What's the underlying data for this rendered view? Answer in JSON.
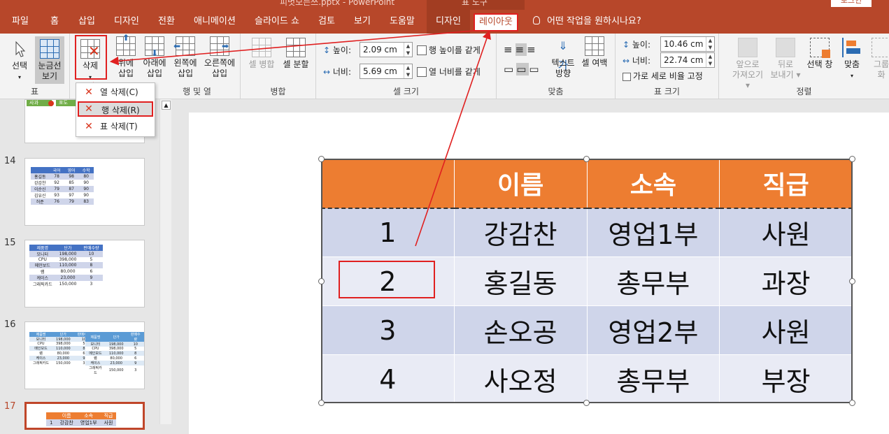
{
  "window": {
    "doc_title": "피벗모든쓰.pptx - PowerPoint",
    "context_group": "표 도구",
    "signin": "로그인"
  },
  "tabs": [
    {
      "label": "파일"
    },
    {
      "label": "홈"
    },
    {
      "label": "삽입"
    },
    {
      "label": "디자인"
    },
    {
      "label": "전환"
    },
    {
      "label": "애니메이션"
    },
    {
      "label": "슬라이드 쇼"
    },
    {
      "label": "검토"
    },
    {
      "label": "보기"
    },
    {
      "label": "도움말"
    },
    {
      "label": "디자인"
    },
    {
      "label": "레이아웃"
    }
  ],
  "tellme": "어떤 작업을 원하시나요?",
  "ribbon": {
    "table_group": {
      "label": "표",
      "select": "선택",
      "gridlines_1": "눈금선",
      "gridlines_2": "보기"
    },
    "rows_cols_group": {
      "label": "행 및 열",
      "delete": "삭제",
      "above_1": "위에",
      "above_2": "삽입",
      "below_1": "아래에",
      "below_2": "삽입",
      "left_1": "왼쪽에",
      "left_2": "삽입",
      "right_1": "오른쪽에",
      "right_2": "삽입"
    },
    "merge_group": {
      "label": "병합",
      "merge_cells": "셀 병합",
      "split_cells": "셀 분할"
    },
    "cell_size_group": {
      "label": "셀 크기",
      "height_label": "높이:",
      "height_value": "2.09 cm",
      "width_label": "너비:",
      "width_value": "5.69 cm",
      "dist_rows": "행 높이를 같게",
      "dist_cols": "열 너비를 같게"
    },
    "align_group": {
      "label": "맞춤",
      "text_dir_1": "텍스트",
      "text_dir_2": "방향",
      "cell_margins": "셀 여백"
    },
    "table_size_group": {
      "label": "표 크기",
      "height_label": "높이:",
      "height_value": "10.46 cm",
      "width_label": "너비:",
      "width_value": "22.74 cm",
      "lock_ratio": "가로 세로 비율 고정"
    },
    "arrange_group": {
      "label": "정렬",
      "bring_forward_1": "앞으로",
      "bring_forward_2": "가져오기",
      "send_backward_1": "뒤로",
      "send_backward_2": "보내기",
      "selection_pane": "선택 창",
      "align": "맞춤",
      "group_1": "그룹",
      "group_2": "화"
    }
  },
  "delete_menu": [
    {
      "label": "열 삭제(C)"
    },
    {
      "label": "행 삭제(R)"
    },
    {
      "label": "표 삭제(T)"
    }
  ],
  "slides": [
    {
      "number": "14"
    },
    {
      "number": "15"
    },
    {
      "number": "16"
    },
    {
      "number": "17"
    }
  ],
  "thumb13": {
    "c1": "사과",
    "c2": "포도"
  },
  "thumb14": {
    "header": [
      "",
      "국어",
      "영어",
      "수학"
    ],
    "rows": [
      [
        "홍길동",
        "78",
        "98",
        "80"
      ],
      [
        "강감찬",
        "92",
        "85",
        "90"
      ],
      [
        "이순신",
        "79",
        "87",
        "90"
      ],
      [
        "김유신",
        "93",
        "97",
        "90"
      ],
      [
        "허준",
        "76",
        "79",
        "83"
      ]
    ]
  },
  "thumb15": {
    "header": [
      "제품명",
      "단가",
      "판매수량"
    ],
    "rows": [
      [
        "모니터",
        "198,000",
        "10"
      ],
      [
        "CPU",
        "398,000",
        "5"
      ],
      [
        "메인보드",
        "110,000",
        "8"
      ],
      [
        "램",
        "80,000",
        "6"
      ],
      [
        "케이스",
        "23,000",
        "9"
      ],
      [
        "그래픽카드",
        "150,000",
        "3"
      ]
    ]
  },
  "thumb16": {
    "header": [
      "제품명",
      "단가",
      "판매수량"
    ],
    "rows": [
      [
        "모니터",
        "198,000",
        "10"
      ],
      [
        "CPU",
        "398,000",
        "5"
      ],
      [
        "메인보드",
        "110,000",
        "8"
      ],
      [
        "램",
        "80,000",
        "6"
      ],
      [
        "케이스",
        "23,000",
        "9"
      ],
      [
        "그래픽카드",
        "150,000",
        "3"
      ]
    ]
  },
  "thumb17": {
    "header": [
      "",
      "이름",
      "소속",
      "직급"
    ],
    "row1": [
      "1",
      "강감찬",
      "영업1부",
      "사원"
    ]
  },
  "table": {
    "header": [
      "",
      "이름",
      "소속",
      "직급"
    ],
    "rows": [
      [
        "1",
        "강감찬",
        "영업1부",
        "사원"
      ],
      [
        "2",
        "홍길동",
        "총무부",
        "과장"
      ],
      [
        "3",
        "손오공",
        "영업2부",
        "사원"
      ],
      [
        "4",
        "사오정",
        "총무부",
        "부장"
      ]
    ]
  },
  "colors": {
    "accent": "#b7472a",
    "header_fill": "#ed7d31",
    "band_dark": "#cfd5ea",
    "band_light": "#e9ebf5",
    "annotation": "#e02020"
  }
}
